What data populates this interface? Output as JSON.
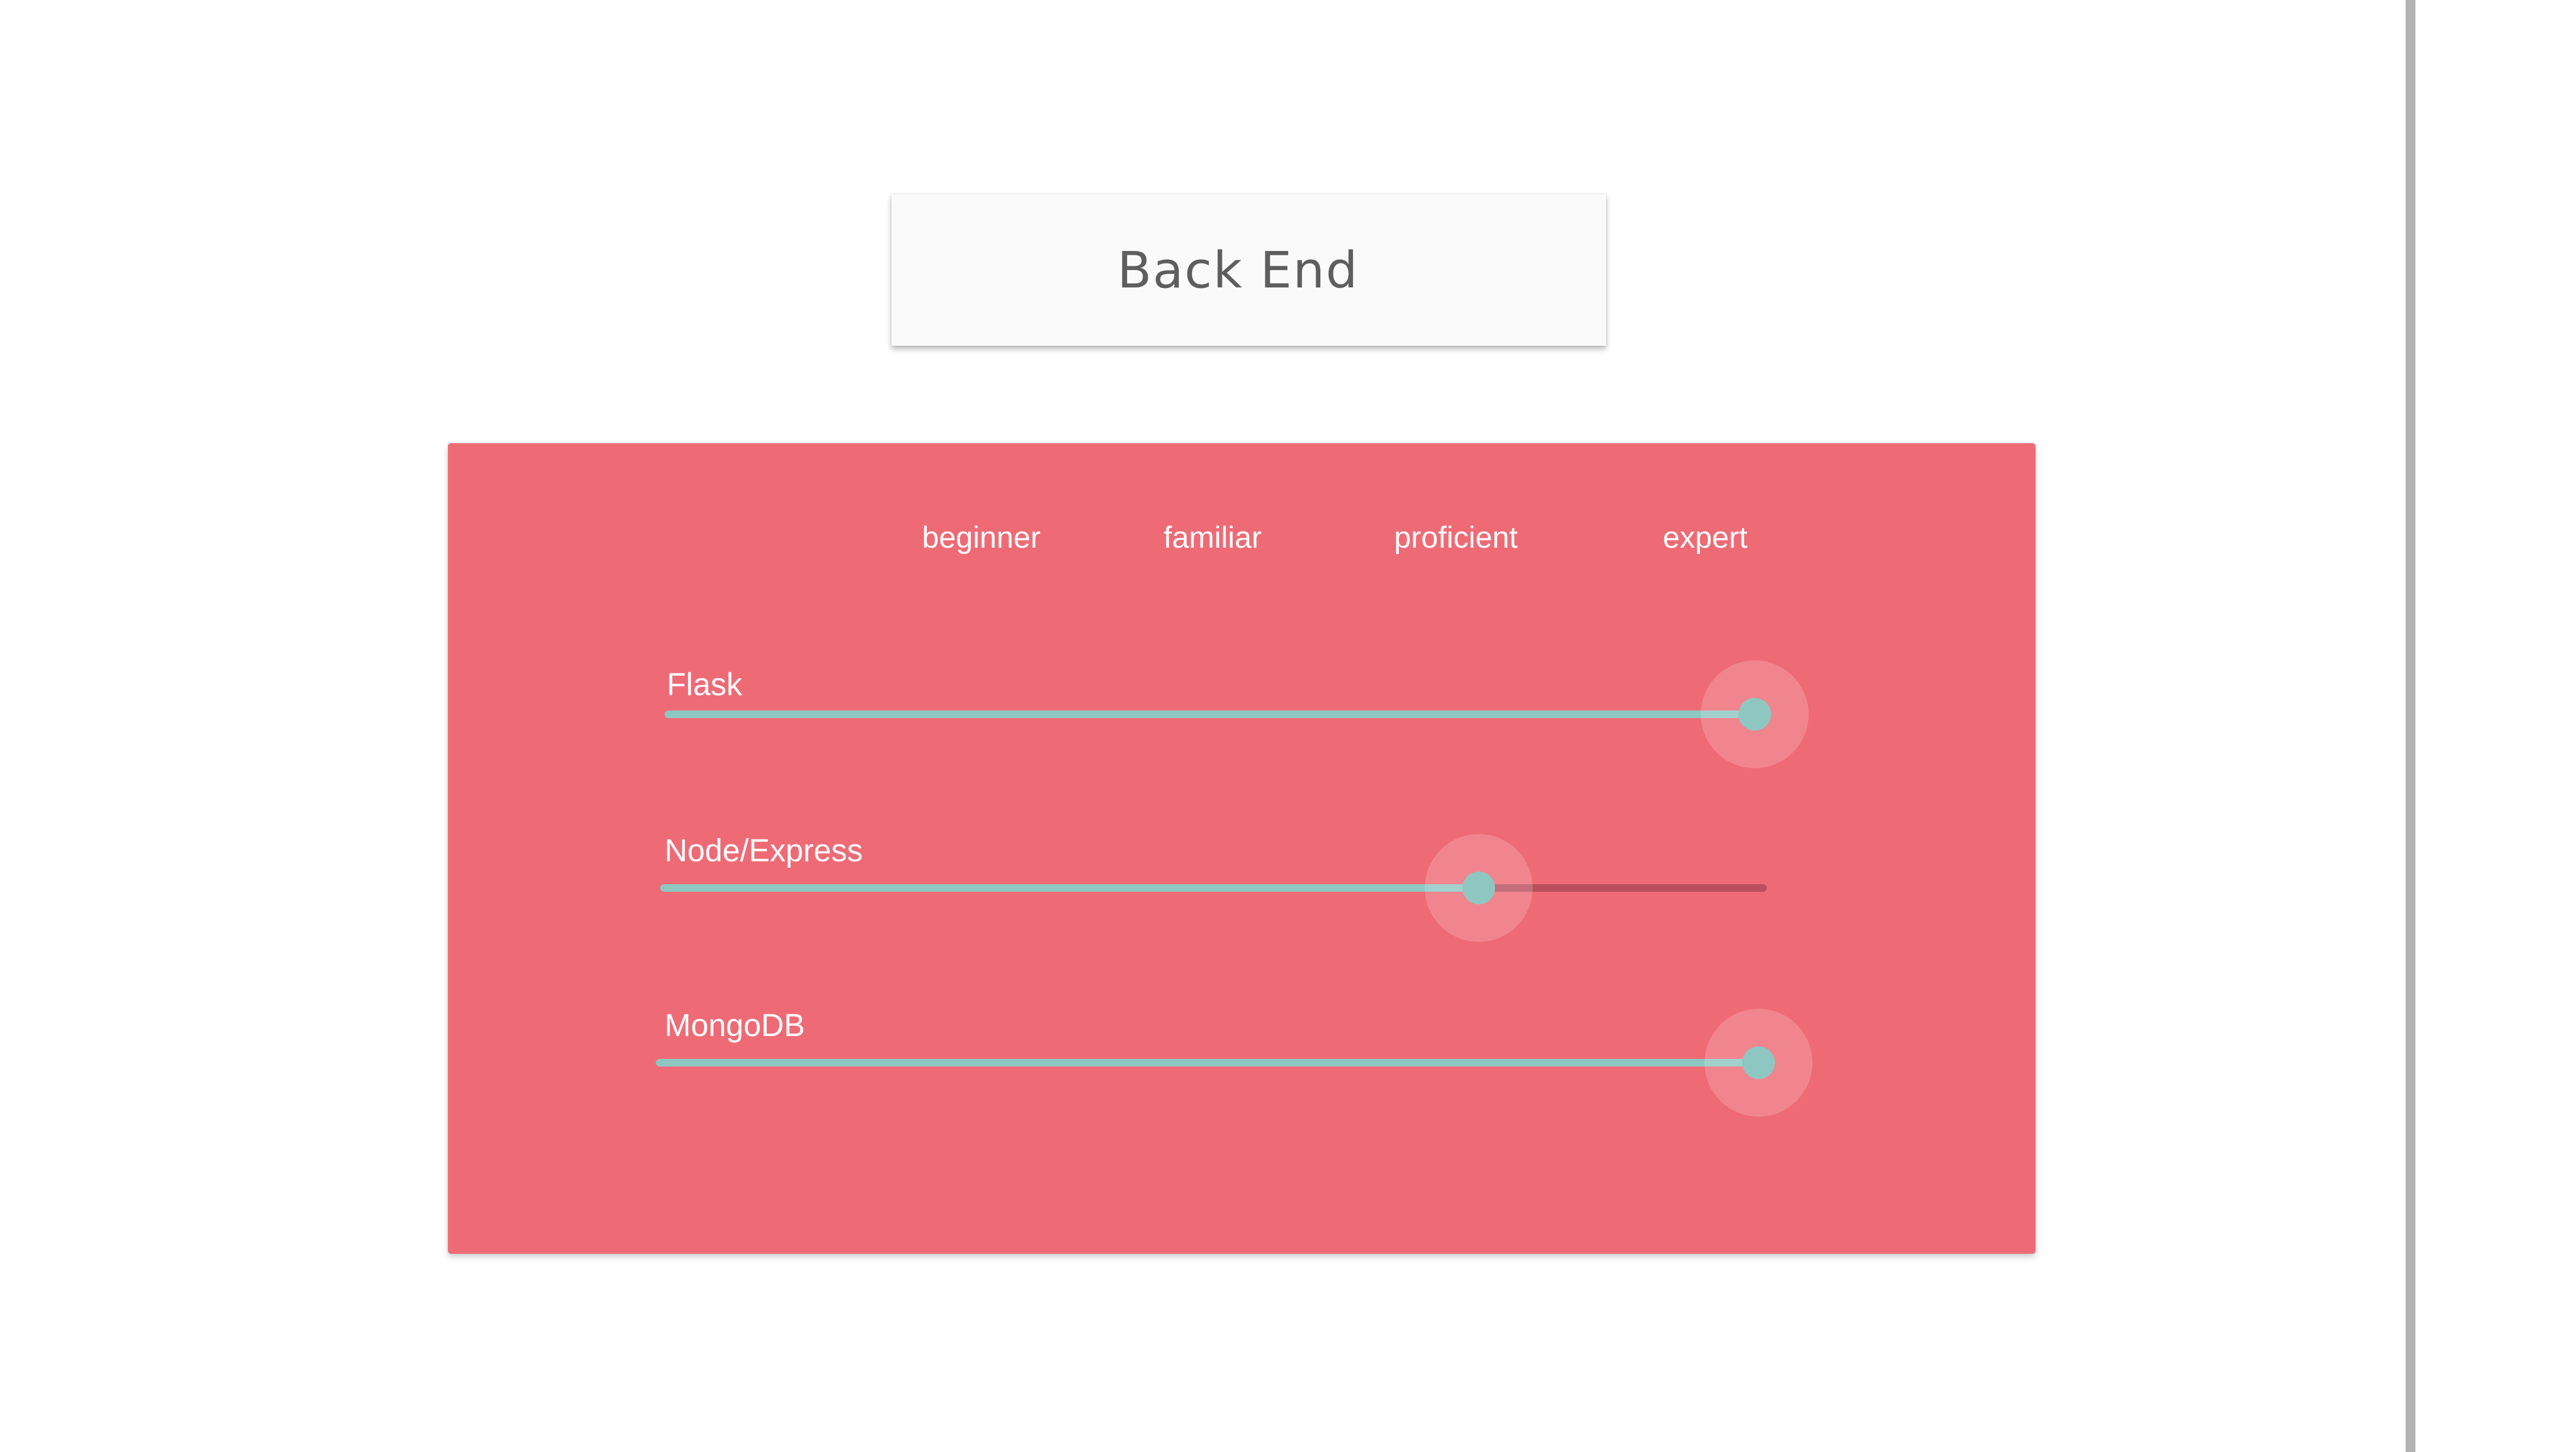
{
  "header": {
    "title": "Back End"
  },
  "levels": [
    "beginner",
    "familiar",
    "proficient",
    "expert"
  ],
  "skills": [
    {
      "name": "Flask",
      "level_fraction": 1.0
    },
    {
      "name": "Node/Express",
      "level_fraction": 0.74
    },
    {
      "name": "MongoDB",
      "level_fraction": 1.0
    }
  ],
  "colors": {
    "card_background": "#ee6b76",
    "slider_accent": "#8ec7c2",
    "slider_track": "#b8505e",
    "title_card_background": "#fafafa"
  }
}
